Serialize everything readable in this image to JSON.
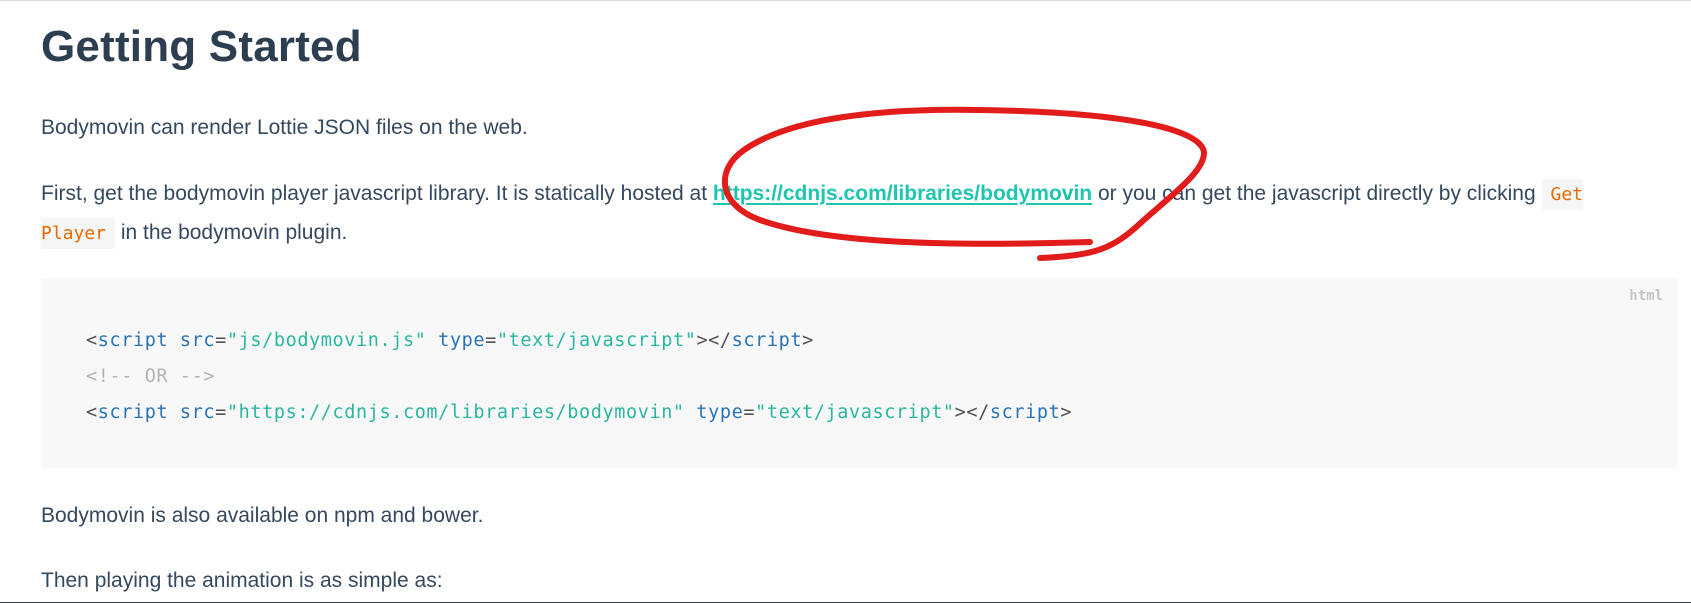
{
  "page": {
    "title": "Getting Started",
    "intro": "Bodymovin can render Lottie JSON files on the web.",
    "second": {
      "before_link": "First, get the bodymovin player javascript library. It is statically hosted at ",
      "link_text": "https://cdnjs.com/libraries/bodymovin",
      "after_link": " or you can get the javascript directly by clicking ",
      "code_text": "Get Player",
      "end": " in the bodymovin plugin."
    },
    "codeblock": {
      "language": "html",
      "line1": {
        "open": "<",
        "tag": "script",
        "attr1": " src",
        "eq1": "=",
        "val1": "\"js/bodymovin.js\"",
        "attr2": " type",
        "eq2": "=",
        "val2": "\"text/javascript\"",
        "close": "></",
        "tag_close": "script",
        "end": ">"
      },
      "line2": "<!-- OR -->",
      "line3": {
        "open": "<",
        "tag": "script",
        "attr1": " src",
        "eq1": "=",
        "val1": "\"https://cdnjs.com/libraries/bodymovin\"",
        "attr2": " type",
        "eq2": "=",
        "val2": "\"text/javascript\"",
        "close": "></",
        "tag_close": "script",
        "end": ">"
      }
    },
    "npm_note": "Bodymovin is also available on npm and bower.",
    "then_note": "Then playing the animation is as simple as:"
  },
  "colors": {
    "heading": "#2c3e50",
    "body_text": "#34495e",
    "link": "#1ec6b0",
    "inline_code": "#e96900",
    "code_bg": "#f8f8f8",
    "annotation": "#e21b1b"
  }
}
